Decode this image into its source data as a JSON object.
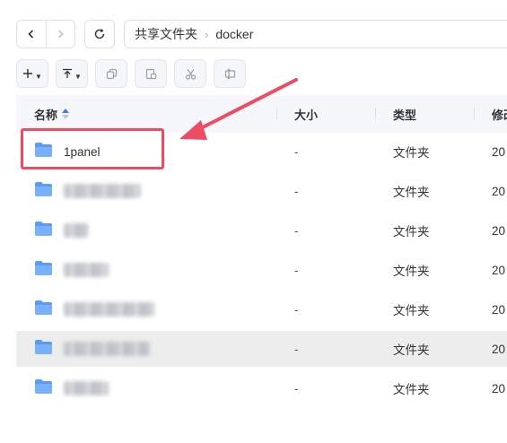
{
  "breadcrumb": {
    "root": "共享文件夹",
    "current": "docker"
  },
  "table": {
    "columns": {
      "name": "名称",
      "size": "大小",
      "type": "类型",
      "modified": "修改"
    },
    "rows": [
      {
        "name": "1panel",
        "size": "-",
        "type": "文件夹",
        "mod": "20",
        "blurred": false
      },
      {
        "name": "",
        "size": "-",
        "type": "文件夹",
        "mod": "20",
        "blurred": true
      },
      {
        "name": "",
        "size": "-",
        "type": "文件夹",
        "mod": "20",
        "blurred": true
      },
      {
        "name": "",
        "size": "-",
        "type": "文件夹",
        "mod": "20",
        "blurred": true
      },
      {
        "name": "",
        "size": "-",
        "type": "文件夹",
        "mod": "20",
        "blurred": true
      },
      {
        "name": "",
        "size": "-",
        "type": "文件夹",
        "mod": "20",
        "blurred": true,
        "highlighted": true
      },
      {
        "name": "",
        "size": "-",
        "type": "文件夹",
        "mod": "20",
        "blurred": true
      }
    ]
  },
  "colors": {
    "accent": "#3f7ef8",
    "folder": "#5b9bf8",
    "annotation": "#ec4d63",
    "row_highlight": "#ededed"
  },
  "icons": [
    "chevron-left-icon",
    "chevron-right-icon",
    "refresh-icon",
    "plus-icon",
    "upload-icon",
    "copy-icon",
    "move-icon",
    "cut-icon",
    "rename-icon",
    "folder-icon",
    "sort-icon"
  ]
}
